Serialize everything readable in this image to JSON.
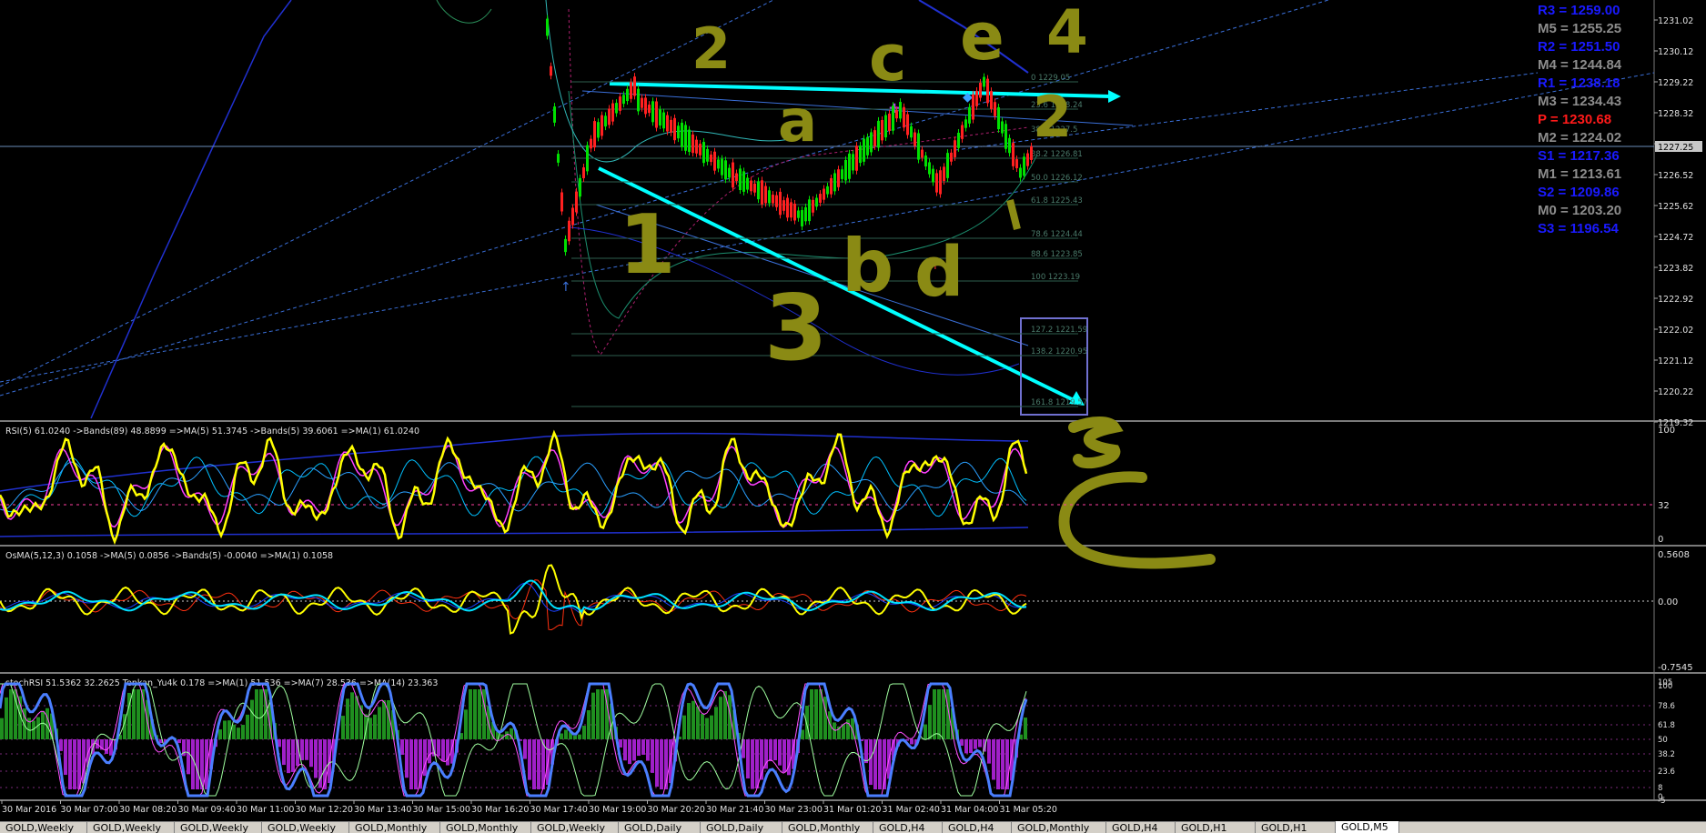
{
  "main_chart": {
    "price_labels": [
      "1231.02",
      "1230.12",
      "1229.22",
      "1228.32",
      "1227.42",
      "1226.52",
      "1225.62",
      "1224.72",
      "1223.82",
      "1222.92",
      "1222.02",
      "1221.12",
      "1220.22",
      "1219.32"
    ],
    "current_price": "1227.25",
    "fib_levels": [
      "0 1229.05",
      "23.6 1228.24",
      "38.2 1226.81",
      "50.0 1226.12",
      "61.8 1225.43",
      "78.6 1224.44",
      "88.6 1223.85",
      "100 1223.19",
      "127.2 1221.59",
      "138.2 1220.95",
      "161.8 1219.57"
    ],
    "fib_label_upper": "38.2 1227.5"
  },
  "pivots": [
    {
      "label": "R3 = 1259.00",
      "color": "#1a1aff"
    },
    {
      "label": "M5 = 1255.25",
      "color": "#8c8c8c"
    },
    {
      "label": "R2 = 1251.50",
      "color": "#1a1aff"
    },
    {
      "label": "M4 = 1244.84",
      "color": "#8c8c8c"
    },
    {
      "label": "R1 = 1238.18",
      "color": "#1a1aff"
    },
    {
      "label": "M3 = 1234.43",
      "color": "#8c8c8c"
    },
    {
      "label": "P   = 1230.68",
      "color": "#ff1a1a"
    },
    {
      "label": "M2 = 1224.02",
      "color": "#8c8c8c"
    },
    {
      "label": "S1 = 1217.36",
      "color": "#1a1aff"
    },
    {
      "label": "M1 = 1213.61",
      "color": "#8c8c8c"
    },
    {
      "label": "S2 = 1209.86",
      "color": "#1a1aff"
    },
    {
      "label": "M0 = 1203.20",
      "color": "#8c8c8c"
    },
    {
      "label": "S3 = 1196.54",
      "color": "#1a1aff"
    }
  ],
  "annotations": {
    "wave_2": "2",
    "wave_c": "c",
    "wave_e": "e",
    "wave_4": "4",
    "wave_2b": "2",
    "wave_a": "a",
    "wave_1": "1",
    "wave_b": "b",
    "wave_d": "d",
    "wave_3": "3"
  },
  "rsi_panel": {
    "header": "RSI(5) 61.0240  ->Bands(89) 48.8899  =>MA(5) 51.3745  ->Bands(5) 39.6061  =>MA(1) 61.0240",
    "scale": [
      "100",
      "32",
      "0"
    ]
  },
  "osma_panel": {
    "header": "OsMA(5,12,3) 0.1058  ->MA(5) 0.0856  ->Bands(5) -0.0040  =>MA(1) 0.1058",
    "scale": [
      "0.5608",
      "0.00",
      "-0.7545"
    ]
  },
  "stoch_panel": {
    "header": "stochRSI 51.5362 32.2625  Tenkan_Yu4k 0.178  =>MA(1) 51.536  =>MA(7) 28.536  =>MA(14) 23.363",
    "scale": [
      "105",
      "100",
      "78.6",
      "61.8",
      "50",
      "38.2",
      "23.6",
      "8",
      "0",
      "-5"
    ]
  },
  "time_axis": [
    "30 Mar 2016",
    "30 Mar 07:00",
    "30 Mar 08:20",
    "30 Mar 09:40",
    "30 Mar 11:00",
    "30 Mar 12:20",
    "30 Mar 13:40",
    "30 Mar 15:00",
    "30 Mar 16:20",
    "30 Mar 17:40",
    "30 Mar 19:00",
    "30 Mar 20:20",
    "30 Mar 21:40",
    "30 Mar 23:00",
    "31 Mar 01:20",
    "31 Mar 02:40",
    "31 Mar 04:00",
    "31 Mar 05:20"
  ],
  "tabs": [
    {
      "label": "GOLD,Weekly",
      "active": false
    },
    {
      "label": "GOLD,Weekly",
      "active": false
    },
    {
      "label": "GOLD,Weekly",
      "active": false
    },
    {
      "label": "GOLD,Weekly",
      "active": false
    },
    {
      "label": "GOLD,Monthly",
      "active": false
    },
    {
      "label": "GOLD,Monthly",
      "active": false
    },
    {
      "label": "GOLD,Weekly",
      "active": false
    },
    {
      "label": "GOLD,Daily",
      "active": false
    },
    {
      "label": "GOLD,Daily",
      "active": false
    },
    {
      "label": "GOLD,Monthly",
      "active": false
    },
    {
      "label": "GOLD,H4",
      "active": false
    },
    {
      "label": "GOLD,H4",
      "active": false
    },
    {
      "label": "GOLD,Monthly",
      "active": false
    },
    {
      "label": "GOLD,H4",
      "active": false
    },
    {
      "label": "GOLD,H1",
      "active": false
    },
    {
      "label": "GOLD,H1",
      "active": false
    },
    {
      "label": "GOLD,M5",
      "active": true
    }
  ],
  "colors": {
    "background": "#000000",
    "grid": "#1a1a1a",
    "candle_up": "#00e000",
    "annotation": "#8a8a14",
    "trendline": "#00ffff",
    "rsi_line": "#ffff00",
    "stoch_line": "#4a7fff",
    "hist_pos": "#1f8f1f",
    "hist_neg": "#a020c8"
  }
}
